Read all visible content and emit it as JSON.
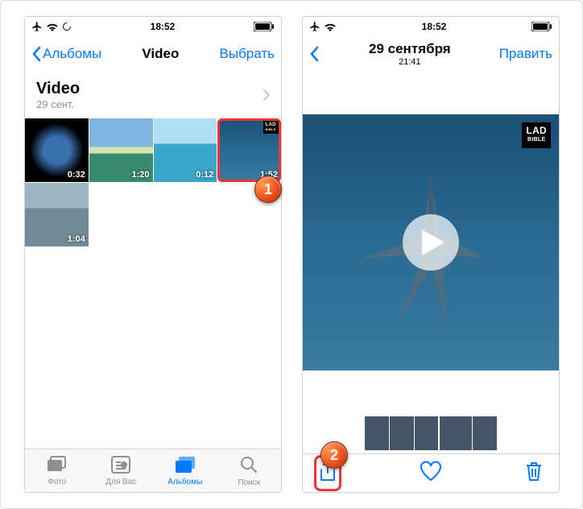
{
  "status": {
    "time": "18:52"
  },
  "left": {
    "nav": {
      "back": "Альбомы",
      "title": "Video",
      "action": "Выбрать"
    },
    "album": {
      "title": "Video",
      "subtitle": "29 сент."
    },
    "thumbs": [
      {
        "dur": "0:32",
        "css": "tEarth"
      },
      {
        "dur": "1:20",
        "css": "tBeach"
      },
      {
        "dur": "0:12",
        "css": "tSea"
      },
      {
        "dur": "1:52",
        "css": "tShark",
        "highlighted": true,
        "lad": true
      },
      {
        "dur": "1:04",
        "css": "tCity"
      }
    ],
    "tabs": [
      {
        "label": "Фото"
      },
      {
        "label": "Для Вас"
      },
      {
        "label": "Альбомы",
        "active": true
      },
      {
        "label": "Поиск"
      }
    ]
  },
  "right": {
    "nav": {
      "title": "29 сентября",
      "subtitle": "21:41",
      "action": "Править"
    },
    "lad_brand": {
      "top": "LAD",
      "bottom": "BIBLE"
    },
    "strip": [
      {
        "css": "tEarth"
      },
      {
        "css": "tBeach"
      },
      {
        "css": "tSea"
      },
      {
        "css": "tShark",
        "sel": true
      },
      {
        "css": "tCity"
      }
    ]
  },
  "annotations": {
    "one": "1",
    "two": "2"
  }
}
